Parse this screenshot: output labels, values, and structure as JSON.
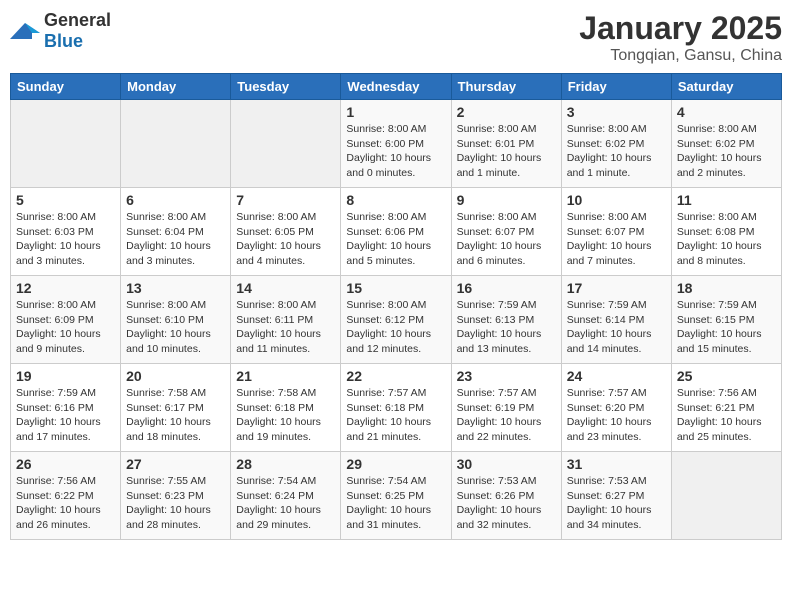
{
  "logo": {
    "general": "General",
    "blue": "Blue"
  },
  "header": {
    "title": "January 2025",
    "subtitle": "Tongqian, Gansu, China"
  },
  "weekdays": [
    "Sunday",
    "Monday",
    "Tuesday",
    "Wednesday",
    "Thursday",
    "Friday",
    "Saturday"
  ],
  "weeks": [
    [
      {
        "day": "",
        "info": ""
      },
      {
        "day": "",
        "info": ""
      },
      {
        "day": "",
        "info": ""
      },
      {
        "day": "1",
        "info": "Sunrise: 8:00 AM\nSunset: 6:00 PM\nDaylight: 10 hours\nand 0 minutes."
      },
      {
        "day": "2",
        "info": "Sunrise: 8:00 AM\nSunset: 6:01 PM\nDaylight: 10 hours\nand 1 minute."
      },
      {
        "day": "3",
        "info": "Sunrise: 8:00 AM\nSunset: 6:02 PM\nDaylight: 10 hours\nand 1 minute."
      },
      {
        "day": "4",
        "info": "Sunrise: 8:00 AM\nSunset: 6:02 PM\nDaylight: 10 hours\nand 2 minutes."
      }
    ],
    [
      {
        "day": "5",
        "info": "Sunrise: 8:00 AM\nSunset: 6:03 PM\nDaylight: 10 hours\nand 3 minutes."
      },
      {
        "day": "6",
        "info": "Sunrise: 8:00 AM\nSunset: 6:04 PM\nDaylight: 10 hours\nand 3 minutes."
      },
      {
        "day": "7",
        "info": "Sunrise: 8:00 AM\nSunset: 6:05 PM\nDaylight: 10 hours\nand 4 minutes."
      },
      {
        "day": "8",
        "info": "Sunrise: 8:00 AM\nSunset: 6:06 PM\nDaylight: 10 hours\nand 5 minutes."
      },
      {
        "day": "9",
        "info": "Sunrise: 8:00 AM\nSunset: 6:07 PM\nDaylight: 10 hours\nand 6 minutes."
      },
      {
        "day": "10",
        "info": "Sunrise: 8:00 AM\nSunset: 6:07 PM\nDaylight: 10 hours\nand 7 minutes."
      },
      {
        "day": "11",
        "info": "Sunrise: 8:00 AM\nSunset: 6:08 PM\nDaylight: 10 hours\nand 8 minutes."
      }
    ],
    [
      {
        "day": "12",
        "info": "Sunrise: 8:00 AM\nSunset: 6:09 PM\nDaylight: 10 hours\nand 9 minutes."
      },
      {
        "day": "13",
        "info": "Sunrise: 8:00 AM\nSunset: 6:10 PM\nDaylight: 10 hours\nand 10 minutes."
      },
      {
        "day": "14",
        "info": "Sunrise: 8:00 AM\nSunset: 6:11 PM\nDaylight: 10 hours\nand 11 minutes."
      },
      {
        "day": "15",
        "info": "Sunrise: 8:00 AM\nSunset: 6:12 PM\nDaylight: 10 hours\nand 12 minutes."
      },
      {
        "day": "16",
        "info": "Sunrise: 7:59 AM\nSunset: 6:13 PM\nDaylight: 10 hours\nand 13 minutes."
      },
      {
        "day": "17",
        "info": "Sunrise: 7:59 AM\nSunset: 6:14 PM\nDaylight: 10 hours\nand 14 minutes."
      },
      {
        "day": "18",
        "info": "Sunrise: 7:59 AM\nSunset: 6:15 PM\nDaylight: 10 hours\nand 15 minutes."
      }
    ],
    [
      {
        "day": "19",
        "info": "Sunrise: 7:59 AM\nSunset: 6:16 PM\nDaylight: 10 hours\nand 17 minutes."
      },
      {
        "day": "20",
        "info": "Sunrise: 7:58 AM\nSunset: 6:17 PM\nDaylight: 10 hours\nand 18 minutes."
      },
      {
        "day": "21",
        "info": "Sunrise: 7:58 AM\nSunset: 6:18 PM\nDaylight: 10 hours\nand 19 minutes."
      },
      {
        "day": "22",
        "info": "Sunrise: 7:57 AM\nSunset: 6:18 PM\nDaylight: 10 hours\nand 21 minutes."
      },
      {
        "day": "23",
        "info": "Sunrise: 7:57 AM\nSunset: 6:19 PM\nDaylight: 10 hours\nand 22 minutes."
      },
      {
        "day": "24",
        "info": "Sunrise: 7:57 AM\nSunset: 6:20 PM\nDaylight: 10 hours\nand 23 minutes."
      },
      {
        "day": "25",
        "info": "Sunrise: 7:56 AM\nSunset: 6:21 PM\nDaylight: 10 hours\nand 25 minutes."
      }
    ],
    [
      {
        "day": "26",
        "info": "Sunrise: 7:56 AM\nSunset: 6:22 PM\nDaylight: 10 hours\nand 26 minutes."
      },
      {
        "day": "27",
        "info": "Sunrise: 7:55 AM\nSunset: 6:23 PM\nDaylight: 10 hours\nand 28 minutes."
      },
      {
        "day": "28",
        "info": "Sunrise: 7:54 AM\nSunset: 6:24 PM\nDaylight: 10 hours\nand 29 minutes."
      },
      {
        "day": "29",
        "info": "Sunrise: 7:54 AM\nSunset: 6:25 PM\nDaylight: 10 hours\nand 31 minutes."
      },
      {
        "day": "30",
        "info": "Sunrise: 7:53 AM\nSunset: 6:26 PM\nDaylight: 10 hours\nand 32 minutes."
      },
      {
        "day": "31",
        "info": "Sunrise: 7:53 AM\nSunset: 6:27 PM\nDaylight: 10 hours\nand 34 minutes."
      },
      {
        "day": "",
        "info": ""
      }
    ]
  ]
}
